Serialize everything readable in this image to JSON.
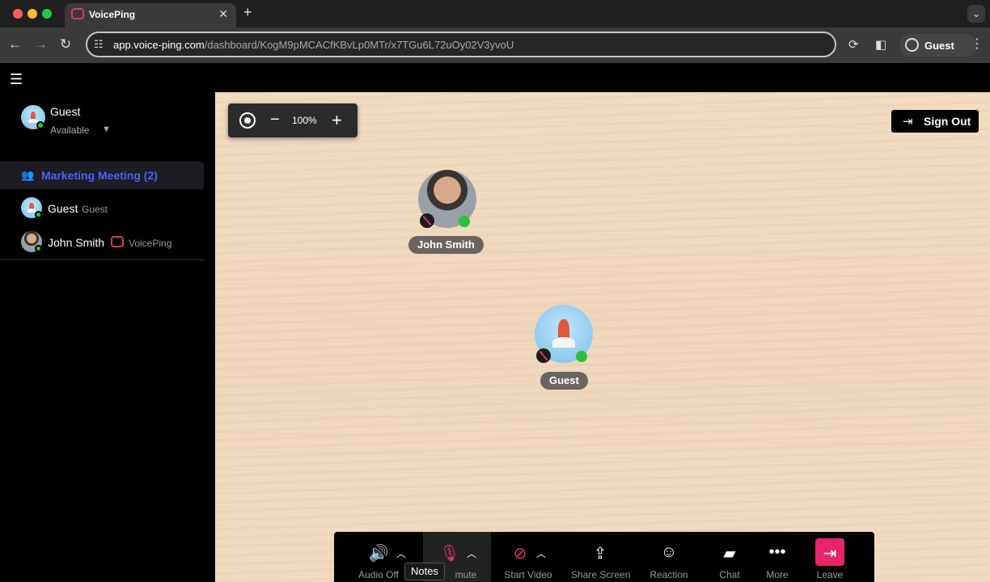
{
  "browser": {
    "tab_title": "VoicePing",
    "url_host": "app.voice-ping.com",
    "url_path": "/dashboard/KogM9pMCACfKBvLp0MTr/x7TGu6L72uOy02V3yvoU",
    "profile_label": "Guest"
  },
  "sidebar": {
    "me": {
      "name": "Guest",
      "status": "Available"
    },
    "room": {
      "label": "Marketing Meeting (2)"
    },
    "members": [
      {
        "name": "Guest",
        "tag": "Guest"
      },
      {
        "name": "John Smith",
        "tag": "VoicePing"
      }
    ]
  },
  "canvas": {
    "zoom_level": "100%",
    "sign_out_label": "Sign Out",
    "avatars": [
      {
        "name": "John Smith"
      },
      {
        "name": "Guest"
      }
    ]
  },
  "toolbar": {
    "audio_label": "Audio Off",
    "mute_label": "mute",
    "tooltip": "Notes",
    "video_label": "Start Video",
    "share_label": "Share Screen",
    "reaction_label": "Reaction",
    "chat_label": "Chat",
    "more_label": "More",
    "leave_label": "Leave"
  },
  "colors": {
    "accent_blue": "#4b63ff",
    "leave_pink": "#e8246a",
    "status_green": "#2fbf3a"
  }
}
